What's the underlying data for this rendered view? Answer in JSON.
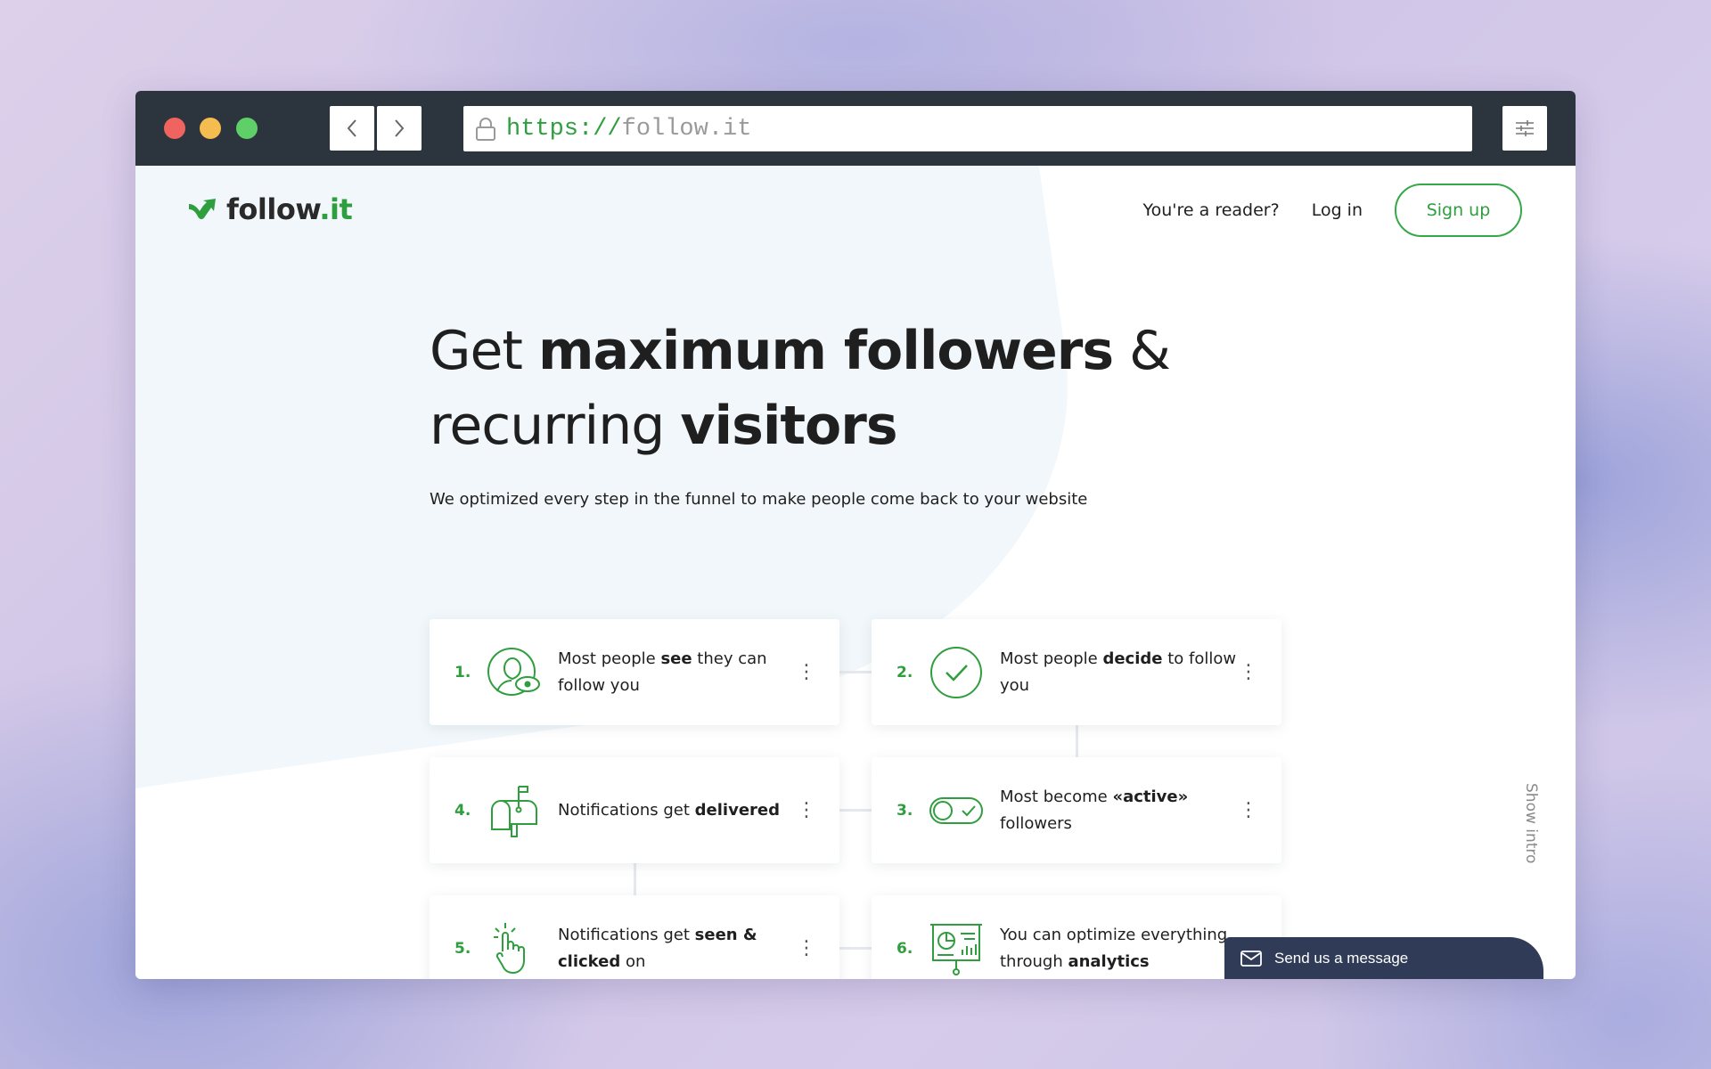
{
  "browser": {
    "url_protocol": "https://",
    "url_host": "follow.it"
  },
  "header": {
    "logo_name": "follow",
    "logo_tld": ".it",
    "reader_link": "You're a reader?",
    "login_link": "Log in",
    "signup_button": "Sign up"
  },
  "hero": {
    "line1_a": "Get ",
    "line1_b": "maximum followers",
    "line1_c": " &",
    "line2_a": "recurring ",
    "line2_b": "visitors",
    "subtitle": "We optimized every step in the funnel to make people come back to your website"
  },
  "steps": [
    {
      "num": "1.",
      "pre": "Most people ",
      "bold": "see",
      "post": " they can follow you",
      "icon": "person-eye-icon"
    },
    {
      "num": "2.",
      "pre": "Most people ",
      "bold": "decide",
      "post": " to follow you",
      "icon": "checkmark-circle-icon"
    },
    {
      "num": "3.",
      "pre": "Most become ",
      "bold": "«active»",
      "post": " followers",
      "icon": "toggle-check-icon"
    },
    {
      "num": "4.",
      "pre": "Notifications get ",
      "bold": "delivered",
      "post": "",
      "icon": "mailbox-icon"
    },
    {
      "num": "5.",
      "pre": "Notifications get ",
      "bold": "seen & clicked",
      "post": " on",
      "icon": "hand-click-icon"
    },
    {
      "num": "6.",
      "pre": "You can optimize everything through ",
      "bold": "analytics",
      "post": "",
      "icon": "presentation-chart-icon"
    }
  ],
  "side_tab": "Show intro",
  "chat": {
    "label": "Send us a message",
    "icon": "envelope-icon"
  },
  "colors": {
    "brand_green": "#2f9e3e",
    "chrome_dark": "#2c353d",
    "chat_bg": "#2f3b57"
  }
}
